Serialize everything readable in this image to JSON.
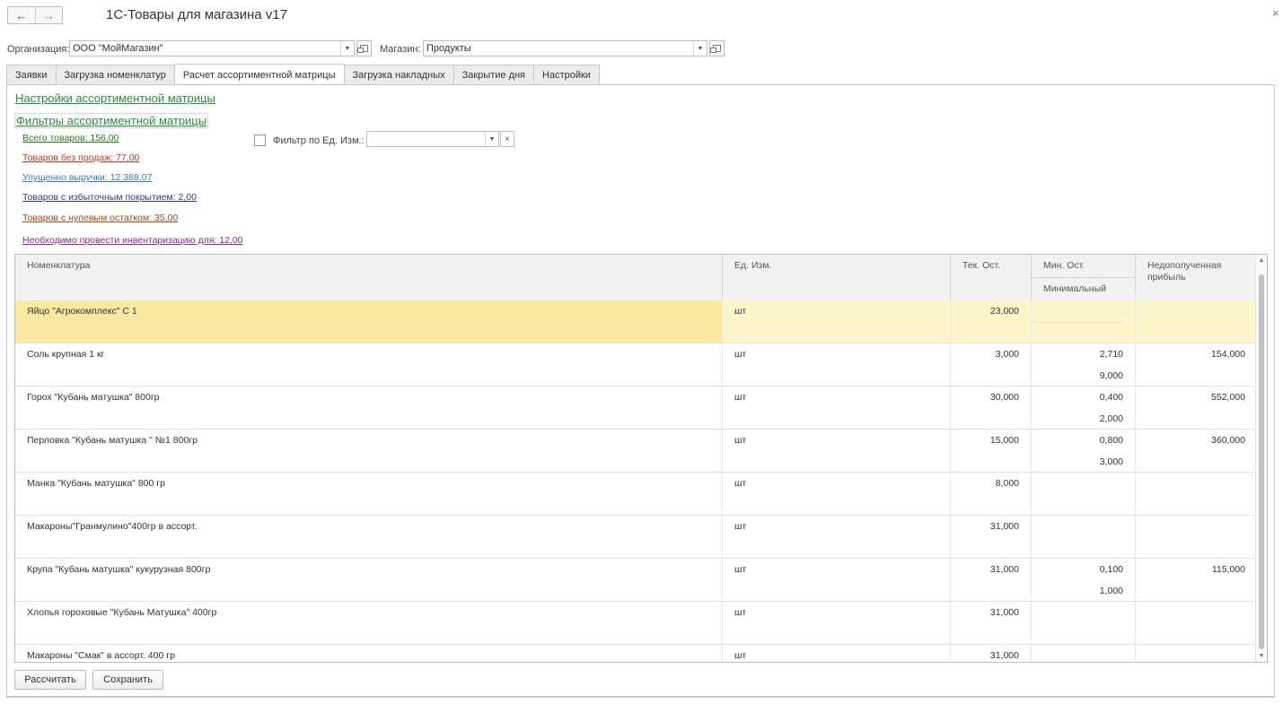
{
  "window": {
    "title": "1С-Товары для магазина v17",
    "back_glyph": "←",
    "forward_glyph": "→",
    "close_glyph": "×"
  },
  "filters": {
    "org_label": "Организация:",
    "org_value": "ООО \"МойМагазин\"",
    "shop_label": "Магазин:",
    "shop_value": "Продукты"
  },
  "tabs": [
    {
      "label": "Заявки",
      "active": false
    },
    {
      "label": "Загрузка номенклатур",
      "active": false
    },
    {
      "label": "Расчет ассортиментной матрицы",
      "active": true
    },
    {
      "label": "Загрузка накладных",
      "active": false
    },
    {
      "label": "Закрытие дня",
      "active": false
    },
    {
      "label": "Настройки",
      "active": false
    }
  ],
  "links": {
    "settings": "Настройки ассортиментной матрицы",
    "filters": "Фильтры ассортиментной матрицы"
  },
  "stats": [
    {
      "text": "Всего товаров: 156,00",
      "color": "#2a7d1e"
    },
    {
      "text": "Товаров без продаж: 77,00",
      "color": "#c0392b"
    },
    {
      "text": "Упущенно выручки: 12 388,07",
      "color": "#3a78c2"
    },
    {
      "text": "Товаров с избыточным покрытием: 2,00",
      "color": "#2c3e8c"
    },
    {
      "text": "Товаров с нулевым остатком: 35,00",
      "color": "#a04a1a"
    },
    {
      "text": "Необходимо провести инвентаризацию для: 12,00",
      "color": "#8e2a8e"
    }
  ],
  "unit_filter": {
    "label": "Фильтр по Ед. Изм.:",
    "value": "",
    "checked": false
  },
  "table": {
    "headers": {
      "name": "Номенклатура",
      "unit": "Ед. Изм.",
      "current": "Тек. Ост.",
      "min": "Мин. Ост.",
      "min_sub": "Минимальный",
      "lost": "Недополученная прибыль"
    },
    "rows": [
      {
        "name": "Яйцо \"Агрокомплекс\" С 1",
        "unit": "шт",
        "current": "23,000",
        "min": "",
        "min_sub": "",
        "lost": "",
        "selected": true
      },
      {
        "name": "Соль крупная 1 кг",
        "unit": "шт",
        "current": "3,000",
        "min": "2,710",
        "min_sub": "9,000",
        "lost": "154,000",
        "selected": false
      },
      {
        "name": "Горох \"Кубань матушка\"  800гр",
        "unit": "шт",
        "current": "30,000",
        "min": "0,400",
        "min_sub": "2,000",
        "lost": "552,000",
        "selected": false
      },
      {
        "name": "Перловка \"Кубань матушка \"  №1 800гр",
        "unit": "шт",
        "current": "15,000",
        "min": "0,800",
        "min_sub": "3,000",
        "lost": "360,000",
        "selected": false
      },
      {
        "name": "Манка \"Кубань матушка\" 800 гр",
        "unit": "шт",
        "current": "8,000",
        "min": "",
        "min_sub": "",
        "lost": "",
        "selected": false
      },
      {
        "name": "Макароны\"Гранмулино\"400гр  в ассорт.",
        "unit": "шт",
        "current": "31,000",
        "min": "",
        "min_sub": "",
        "lost": "",
        "selected": false
      },
      {
        "name": "Крупа \"Кубань матушка\" кукурузная 800гр",
        "unit": "шт",
        "current": "31,000",
        "min": "0,100",
        "min_sub": "1,000",
        "lost": "115,000",
        "selected": false
      },
      {
        "name": "Хлопья гороховые \"Кубань Матушка\" 400гр",
        "unit": "шт",
        "current": "31,000",
        "min": "",
        "min_sub": "",
        "lost": "",
        "selected": false
      },
      {
        "name": "Макароны \"Смак\" в ассорт. 400 гр",
        "unit": "шт",
        "current": "31,000",
        "min": "",
        "min_sub": "",
        "lost": "",
        "selected": false
      }
    ]
  },
  "buttons": {
    "calculate": "Рассчитать",
    "save": "Сохранить"
  },
  "icons": {
    "dropdown": "▼",
    "clear": "×",
    "scroll_up": "▲",
    "scroll_down": "▼"
  }
}
